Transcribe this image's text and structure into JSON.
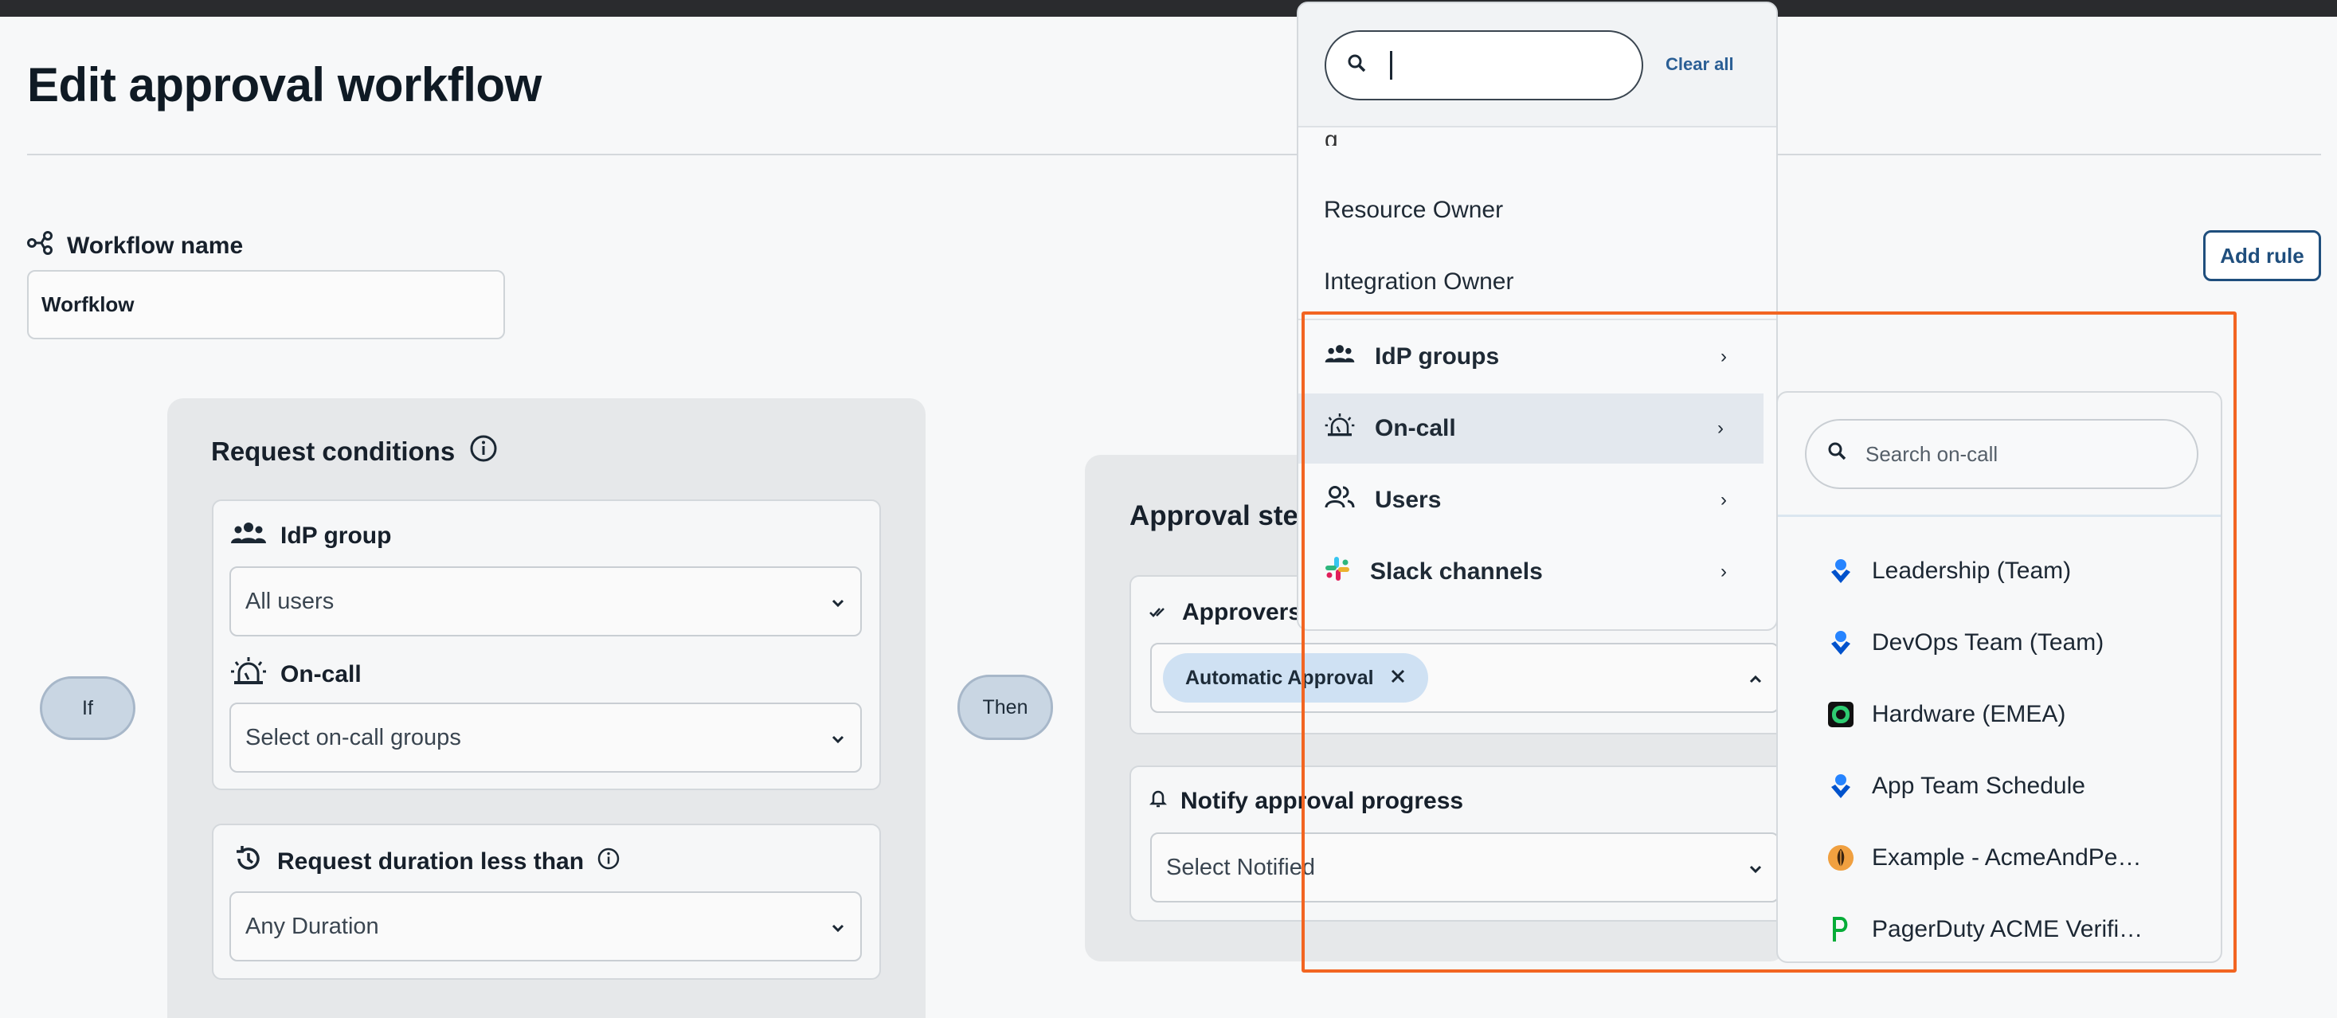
{
  "page": {
    "title": "Edit approval workflow"
  },
  "workflow": {
    "name_label": "Workflow name",
    "name_value": "Worfklow"
  },
  "toolbar": {
    "add_rule_label": "Add rule"
  },
  "flow": {
    "if_label": "If",
    "then_label": "Then"
  },
  "conditions": {
    "title": "Request conditions",
    "idp_label": "IdP group",
    "idp_value": "All users",
    "oncall_label": "On-call",
    "oncall_placeholder": "Select on-call groups",
    "duration_label": "Request duration less than",
    "duration_value": "Any Duration"
  },
  "approval": {
    "title": "Approval steps",
    "approvers_label": "Approvers",
    "approvers_chip": "Automatic Approval",
    "notify_label": "Notify approval progress",
    "notify_placeholder": "Select Notified"
  },
  "menu": {
    "search_value": "",
    "clear_all": "Clear all",
    "items": [
      "Resource Owner",
      "Integration Owner"
    ],
    "submenus": [
      {
        "label": "IdP groups",
        "icon": "group-icon"
      },
      {
        "label": "On-call",
        "icon": "siren-icon"
      },
      {
        "label": "Users",
        "icon": "users-icon"
      },
      {
        "label": "Slack channels",
        "icon": "slack-icon"
      }
    ]
  },
  "oncall_submenu": {
    "search_placeholder": "Search on-call",
    "items": [
      {
        "label": "Leadership (Team)",
        "icon": "opsgenie-icon"
      },
      {
        "label": "DevOps Team (Team)",
        "icon": "opsgenie-icon"
      },
      {
        "label": "Hardware (EMEA)",
        "icon": "schedule-green-icon"
      },
      {
        "label": "App Team Schedule",
        "icon": "opsgenie-icon"
      },
      {
        "label": "Example - AcmeAndPe…",
        "icon": "leaf-orange-icon"
      },
      {
        "label": "PagerDuty ACME Verifi…",
        "icon": "pagerduty-icon"
      }
    ]
  },
  "colors": {
    "accent": "#1f4e7d",
    "highlight": "#f26522",
    "chip": "#cfe1f3"
  }
}
